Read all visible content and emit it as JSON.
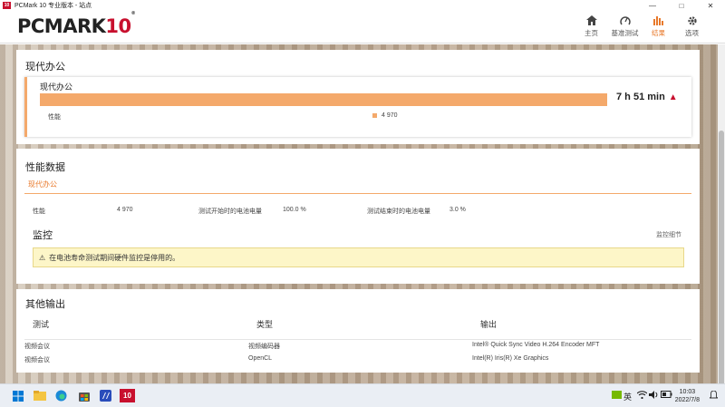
{
  "window": {
    "title": "PCMark 10 专业版本 - 站点",
    "app_icon_text": "10",
    "controls": [
      "minimize",
      "maximize",
      "close"
    ]
  },
  "header": {
    "logo_main": "PCMARK",
    "logo_num": "10",
    "logo_reg": "®",
    "nav": [
      {
        "label": "主页",
        "icon": "home-icon",
        "active": false
      },
      {
        "label": "基准测试",
        "icon": "gauge-icon",
        "active": false
      },
      {
        "label": "结果",
        "icon": "bar-chart-icon",
        "active": true
      },
      {
        "label": "选项",
        "icon": "gear-icon",
        "active": false
      }
    ],
    "accent_color": "#e8792b"
  },
  "summary": {
    "title": "现代办公",
    "inner_title": "现代办公",
    "bar_fraction": 1.0,
    "battery_life": "7 h 51 min",
    "perf_label": "性能",
    "perf_value": "4 970",
    "bar_color": "#f4a96b"
  },
  "performance": {
    "title": "性能数据",
    "tab": "现代办公",
    "perf_label": "性能",
    "perf_value": "4 970",
    "start_battery_label": "测试开始时的电池电量",
    "start_battery_value": "100.0 %",
    "end_battery_label": "测试结束时的电池电量",
    "end_battery_value": "3.0 %",
    "monitor_title": "监控",
    "monitor_link": "监控细节",
    "alert_text": "在电池寿命测试期间硬件监控是停用的。"
  },
  "other_output": {
    "title": "其他输出",
    "columns": [
      "测试",
      "类型",
      "输出"
    ],
    "rows": [
      [
        "视频会议",
        "视频编码器",
        "Intel® Quick Sync Video H.264 Encoder MFT"
      ],
      [
        "视频会议",
        "OpenCL",
        "Intel(R) Iris(R) Xe Graphics"
      ]
    ]
  },
  "taskbar": {
    "pinned_app_label": "10",
    "ime": "英",
    "time": "10:03",
    "date": "2022/7/8"
  }
}
